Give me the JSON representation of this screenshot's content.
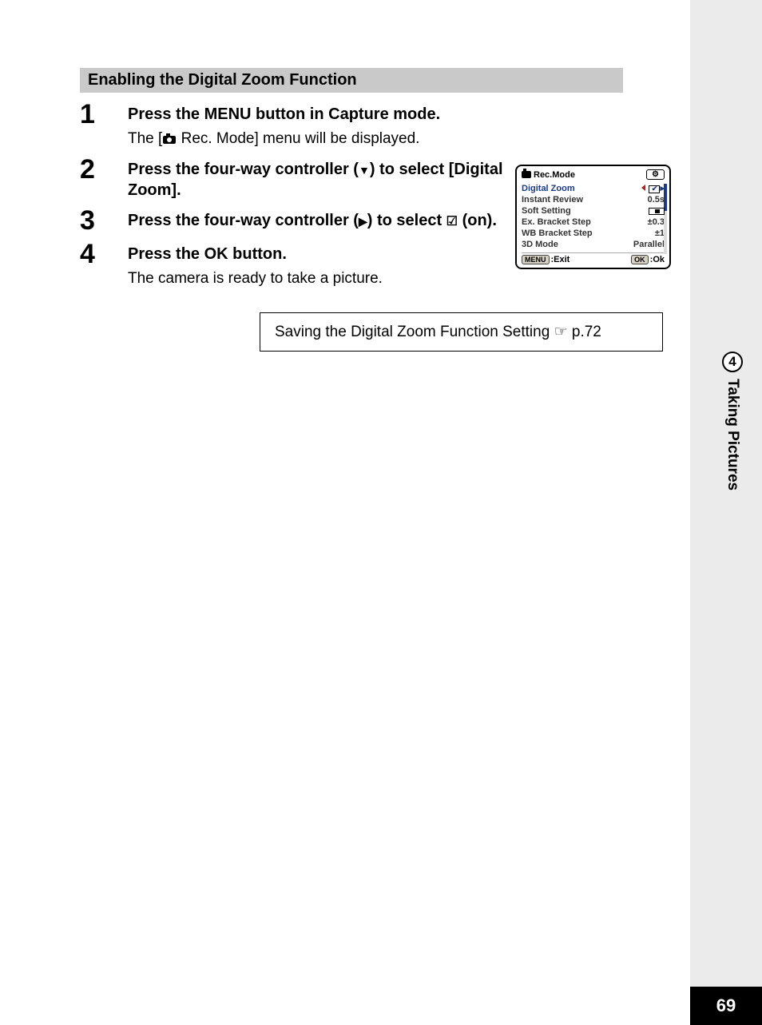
{
  "section_heading": "Enabling the Digital Zoom Function",
  "steps": [
    {
      "num": "1",
      "title": "Press the MENU button in Capture mode.",
      "note_prefix": "The [",
      "note_suffix": " Rec. Mode] menu will be displayed."
    },
    {
      "num": "2",
      "title_a": "Press the four-way controller (",
      "title_b": ") to select [Digital Zoom]."
    },
    {
      "num": "3",
      "title_a": "Press the four-way controller (",
      "title_b": ") to select ",
      "title_c": " (on)."
    },
    {
      "num": "4",
      "title": "Press the OK button.",
      "note": "The camera is ready to take a picture."
    }
  ],
  "refbox": "Saving the Digital Zoom Function Setting ☞ p.72",
  "sidetab": {
    "num": "4",
    "text": "Taking Pictures"
  },
  "page_number": "69",
  "lcd": {
    "title": "Rec.Mode",
    "tab_icon": "⚙",
    "rows": [
      {
        "label": "Digital Zoom",
        "value_icon": "check",
        "highlight": true
      },
      {
        "label": "Instant Review",
        "value": "0.5s"
      },
      {
        "label": "Soft Setting",
        "value_icon": "slider"
      },
      {
        "label": "Ex. Bracket Step",
        "value": "±0.3"
      },
      {
        "label": "WB Bracket Step",
        "value": "±1"
      },
      {
        "label": "3D Mode",
        "value": "Parallel"
      }
    ],
    "footer": {
      "menu_label": "MENU",
      "menu_action": ":Exit",
      "ok_label": "OK",
      "ok_action": ":Ok"
    }
  }
}
